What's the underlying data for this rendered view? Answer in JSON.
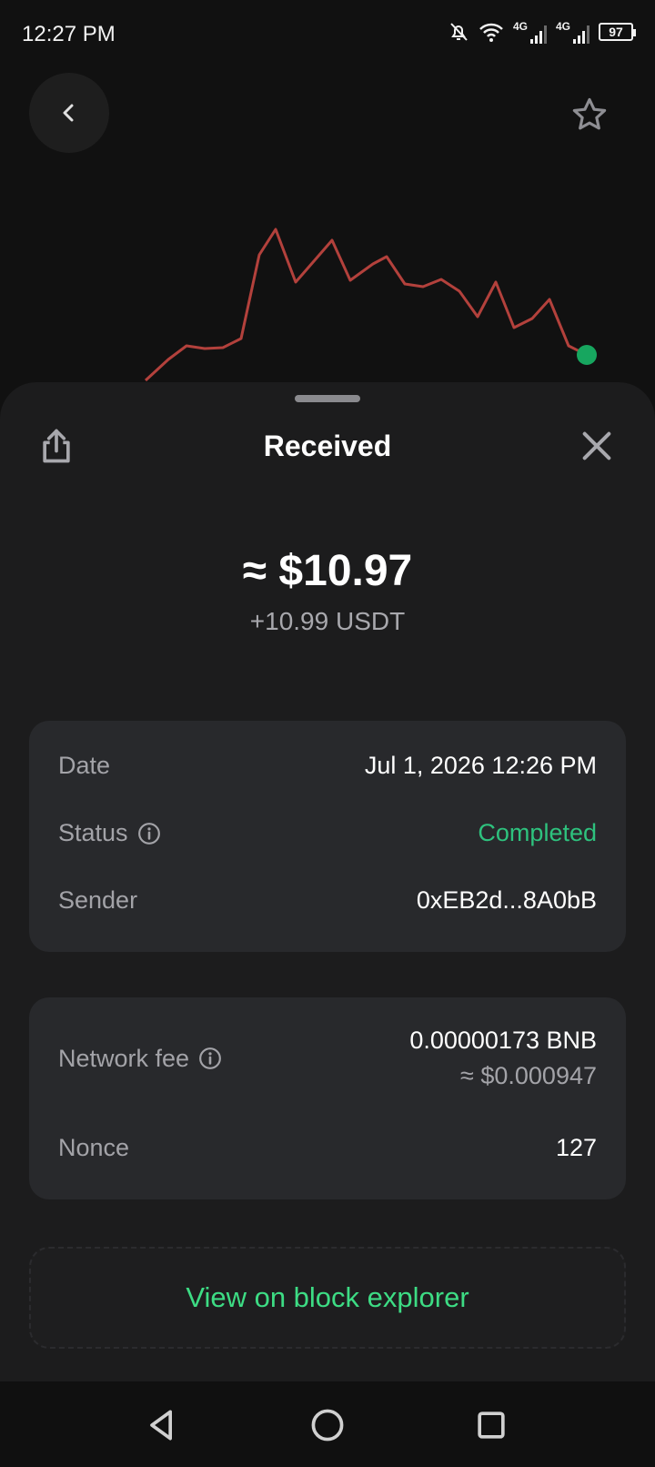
{
  "status_bar": {
    "time": "12:27 PM",
    "network1": "4G",
    "network2": "4G",
    "battery": "97"
  },
  "sheet": {
    "title": "Received"
  },
  "amount": {
    "fiat": "≈ $10.97",
    "crypto": "+10.99 USDT"
  },
  "details": {
    "date_label": "Date",
    "date_value": "Jul 1, 2026 12:26 PM",
    "status_label": "Status",
    "status_value": "Completed",
    "sender_label": "Sender",
    "sender_value": "0xEB2d...8A0bB"
  },
  "fees": {
    "fee_label": "Network fee",
    "fee_value": "0.00000173 BNB",
    "fee_fiat": "≈ $0.000947",
    "nonce_label": "Nonce",
    "nonce_value": "127"
  },
  "explorer": {
    "label": "View on block explorer"
  },
  "colors": {
    "accent_green": "#3ddc84",
    "status_green": "#2ec27e",
    "chart_line": "#b3413c",
    "chart_dot": "#17a65f"
  },
  "icons": [
    "bell-off-icon",
    "wifi-icon",
    "signal-icon",
    "battery-icon",
    "back-icon",
    "star-icon",
    "share-icon",
    "close-icon",
    "info-icon",
    "nav-back-icon",
    "nav-home-icon",
    "nav-recents-icon"
  ]
}
